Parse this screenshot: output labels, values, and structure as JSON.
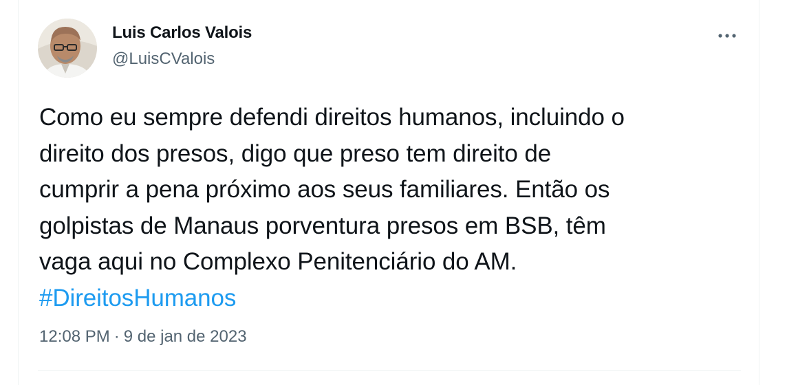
{
  "author": {
    "name": "Luis Carlos Valois",
    "handle": "@LuisCValois"
  },
  "tweet": {
    "lines": [
      "Como eu sempre defendi direitos humanos, incluindo o",
      "direito dos presos, digo que preso tem direito de",
      "cumprir a pena próximo aos seus familiares. Então os",
      "golpistas de Manaus porventura presos em BSB, têm",
      "vaga aqui no Complexo Penitenciário do AM."
    ],
    "hashtag": "#DireitosHumanos"
  },
  "meta": {
    "time": "12:08 PM",
    "separator": "·",
    "date": "9 de jan de 2023"
  },
  "icons": {
    "more": "more-horizontal-icon",
    "avatar": "profile-photo"
  },
  "colors": {
    "text_primary": "#0f1419",
    "text_secondary": "#536471",
    "link": "#1d9bf0",
    "border": "#eff3f4"
  }
}
